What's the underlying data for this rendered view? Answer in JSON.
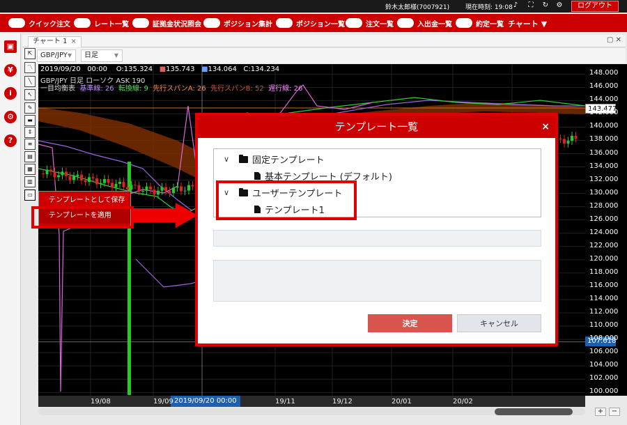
{
  "topbar": {
    "user": "鈴木太郎様(7007921)",
    "time": "現在時刻: 19:08",
    "logout": "ログアウト"
  },
  "menu": {
    "items": [
      "クイック注文",
      "レート一覧",
      "証拠金状況照会",
      "ポジション集計",
      "ポジション一覧",
      "注文一覧",
      "入出金一覧",
      "約定一覧"
    ],
    "chart_menu": "チャート ▼"
  },
  "sidebar": {
    "icons": [
      "save-icon",
      "yen-icon",
      "info-icon",
      "gear-icon",
      "help-icon"
    ]
  },
  "chart_panel": {
    "tab_label": "チャート 1",
    "tab_close": "×",
    "panel_buttons": "▢ ✕",
    "pair": "GBP/JPY",
    "period": "日足",
    "ohlc_date": "2019/09/20",
    "ohlc_time": "00:00",
    "open": "O:135.324",
    "high": "135.743",
    "low": "134.064",
    "close": "C:134.234",
    "info_line": "GBP/JPY  日足  ローソク  ASK  190",
    "ichimoku_label": "一目均衡表",
    "base_line": "基準線: 26",
    "conversion_line": "転換線: 9",
    "span_a": "先行スパンA: 26",
    "span_b": "先行スパンB: 52",
    "lagging_line": "遅行線: 26",
    "current_price": "143.477",
    "cursor_price": "107.618",
    "cursor_date": "2019/09/20 00:00"
  },
  "chart_data": {
    "type": "candlestick",
    "yticks": [
      "148.000",
      "146.000",
      "144.000",
      "142.000",
      "140.000",
      "138.000",
      "136.000",
      "134.000",
      "132.000",
      "130.000",
      "128.000",
      "126.000",
      "124.000",
      "122.000",
      "120.000",
      "118.000",
      "116.000",
      "114.000",
      "112.000",
      "110.000",
      "108.000",
      "106.000",
      "104.000",
      "102.000",
      "100.000"
    ],
    "xticks": [
      "19/08",
      "19/09",
      "19/11",
      "19/12",
      "20/01",
      "20/02"
    ],
    "ylim": [
      99.5,
      149.5
    ]
  },
  "context_menu": {
    "items": [
      "テンプレートとして保存",
      "テンプレートを適用"
    ]
  },
  "dialog": {
    "title": "テンプレート一覧",
    "close": "×",
    "fixed_folder": "固定テンプレート",
    "fixed_item": "基本テンプレート (デフォルト)",
    "user_folder": "ユーザーテンプレート",
    "user_item": "テンプレート1",
    "ok": "決定",
    "cancel": "キャンセル"
  }
}
